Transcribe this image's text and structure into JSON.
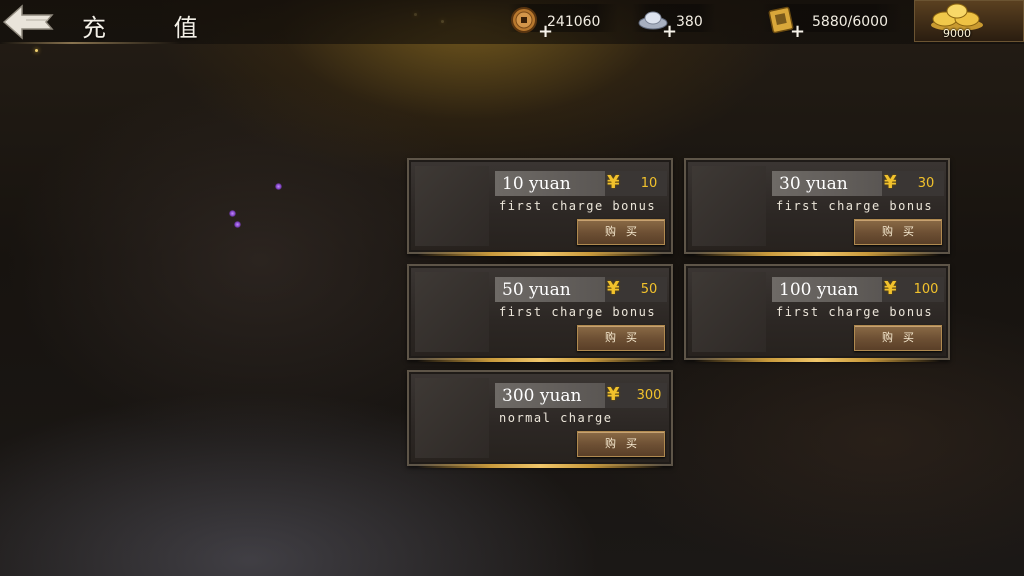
{
  "header": {
    "title": "充 值",
    "resources": {
      "coin": {
        "value": "241060",
        "icon": "copper-coin-icon"
      },
      "silver": {
        "value": "380",
        "icon": "silver-ingot-icon"
      },
      "stamina": {
        "value": "5880/6000",
        "icon": "scroll-book-icon"
      },
      "gold": {
        "value": "9000",
        "icon": "gold-ingot-pile-icon"
      }
    }
  },
  "packages": [
    {
      "name": "10 yuan",
      "currency": "¥",
      "price": "10",
      "desc": "first charge bonus",
      "buy": "购买"
    },
    {
      "name": "30 yuan",
      "currency": "¥",
      "price": "30",
      "desc": "first charge bonus",
      "buy": "购买"
    },
    {
      "name": "50 yuan",
      "currency": "¥",
      "price": "50",
      "desc": "first charge bonus",
      "buy": "购买"
    },
    {
      "name": "100 yuan",
      "currency": "¥",
      "price": "100",
      "desc": "first charge bonus",
      "buy": "购买"
    },
    {
      "name": "300 yuan",
      "currency": "¥",
      "price": "300",
      "desc": "normal charge",
      "buy": "购买"
    }
  ],
  "colors": {
    "accent_gold": "#f2c22c",
    "card_border": "#5e5548",
    "buy_button": "#6c4f33"
  }
}
